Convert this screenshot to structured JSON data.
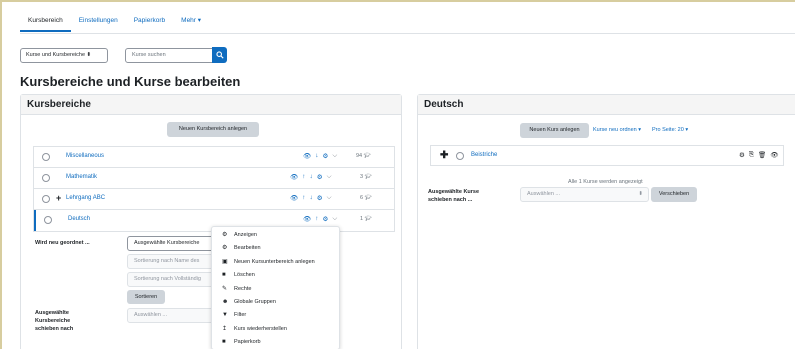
{
  "nav": {
    "tabs": [
      "Kursbereich",
      "Einstellungen",
      "Papierkorb",
      "Mehr ▾"
    ],
    "active_index": 0
  },
  "filter": {
    "view_select": "Kurse und Kursbereiche ⬍",
    "search_placeholder": "Kurse suchen"
  },
  "page_title": "Kursbereiche und Kurse bearbeiten",
  "left_panel": {
    "title": "Kursbereiche",
    "new_button": "Neuen Kursbereich anlegen",
    "categories": [
      {
        "name": "Miscellaneous",
        "count": "94"
      },
      {
        "name": "Mathematik",
        "count": "3"
      },
      {
        "name": "Lehrgang ABC",
        "count": "6"
      },
      {
        "name": "Deutsch",
        "count": "1"
      }
    ],
    "resort_label": "Wird neu geordnet ...",
    "resort_select": "Ausgewählte Kursbereiche",
    "sort_name": "Sortierung nach Name des",
    "sort_full": "Sortierung nach Vollständig",
    "sort_button": "Sortieren",
    "move_label_1": "Ausgewählte",
    "move_label_2": "Kursbereiche",
    "move_label_3": "schieben nach",
    "move_select": "Auswählen ..."
  },
  "menu": {
    "items": [
      {
        "icon": "⚙",
        "label": "Anzeigen"
      },
      {
        "icon": "⚙",
        "label": "Bearbeiten"
      },
      {
        "icon": "▣",
        "label": "Neuen Kursunterbereich anlegen"
      },
      {
        "icon": "■",
        "label": "Löschen"
      },
      {
        "icon": "✎",
        "label": "Rechte"
      },
      {
        "icon": "☻",
        "label": "Globale Gruppen"
      },
      {
        "icon": "▼",
        "label": "Filter"
      },
      {
        "icon": "↥",
        "label": "Kurs wiederherstellen"
      },
      {
        "icon": "■",
        "label": "Papierkorb"
      }
    ]
  },
  "right_panel": {
    "title": "Deutsch",
    "new_course_button": "Neuen Kurs anlegen",
    "reorder_link": "Kurse neu ordnen ▾",
    "per_page_link": "Pro Seite: 20 ▾",
    "course_name": "Beistriche",
    "shown_text": "Alle 1 Kurse werden angezeigt",
    "move_label_1": "Ausgewählte Kurse",
    "move_label_2": "schieben nach ...",
    "move_select": "Auswählen ...",
    "move_button": "Verschieben"
  },
  "colors": {
    "primary": "#0f6cbf",
    "button_grey": "#ced4da",
    "frame": "#d7cd9f"
  }
}
